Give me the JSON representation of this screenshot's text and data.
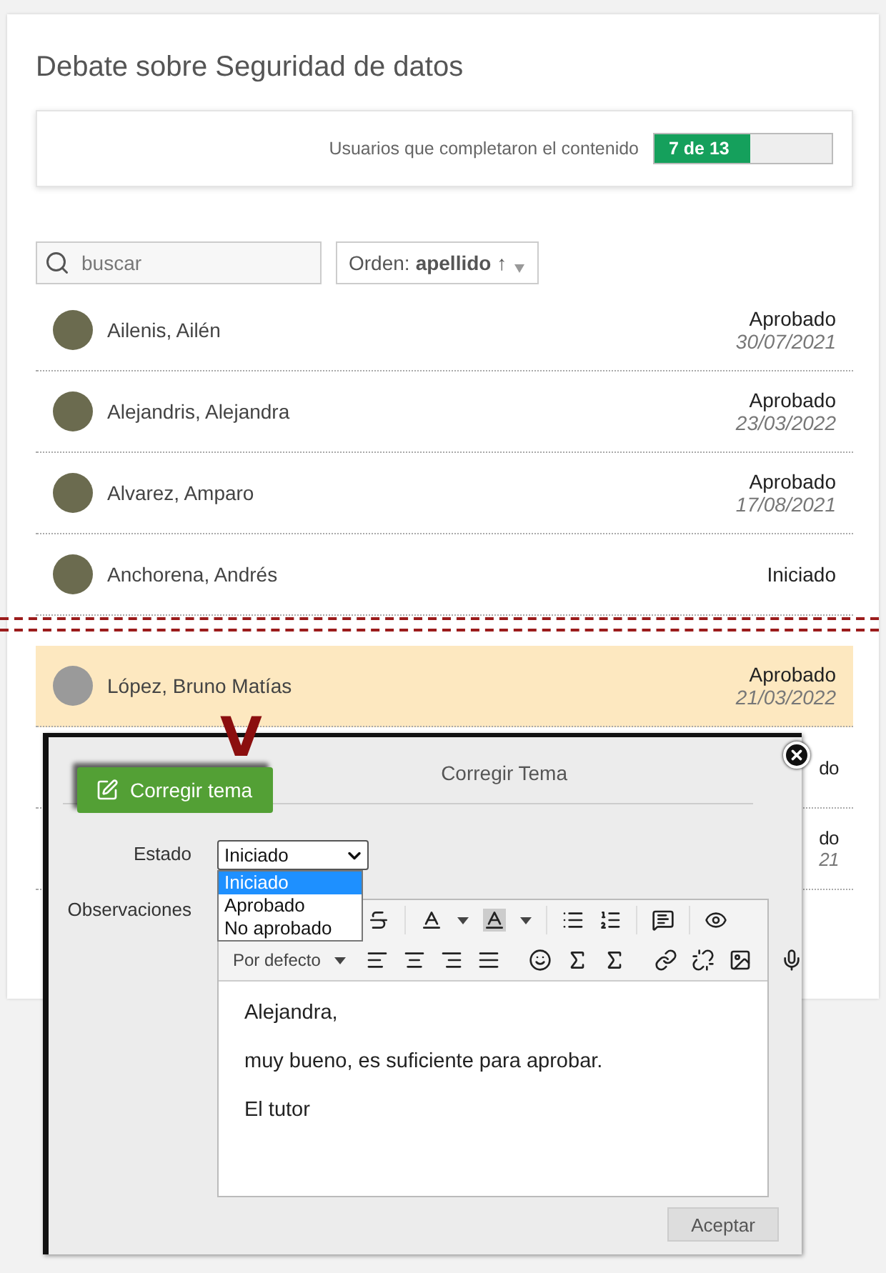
{
  "title": "Debate sobre Seguridad de datos",
  "progress": {
    "label": "Usuarios que completaron el contenido",
    "value": "7 de 13",
    "level": 0.54
  },
  "search": {
    "placeholder": "buscar"
  },
  "sort": {
    "label": "Orden:",
    "value": "apellido ↑"
  },
  "users": [
    {
      "name": "Ailenis, Ailén",
      "status": "Aprobado",
      "date": "30/07/2021",
      "kind": "photo",
      "highlighted": false
    },
    {
      "name": "Alejandris, Alejandra",
      "status": "Aprobado",
      "date": "23/03/2022",
      "kind": "photo",
      "highlighted": false
    },
    {
      "name": "Alvarez, Amparo",
      "status": "Aprobado",
      "date": "17/08/2021",
      "kind": "photo",
      "highlighted": false
    },
    {
      "name": "Anchorena, Andrés",
      "status": "Iniciado",
      "kind": "photo",
      "highlighted": false
    }
  ],
  "users_after_cut": [
    {
      "name": "López, Bruno Matías",
      "status": "Aprobado",
      "date": "21/03/2022",
      "kind": "silhouette",
      "highlighted": true
    }
  ],
  "covered_rows": [
    {
      "status": "do"
    },
    {
      "status": "do",
      "date": "21"
    }
  ],
  "marker": "V",
  "dialog": {
    "title": "Corregir Tema",
    "tab_button": "Corregir tema",
    "estado": {
      "label": "Estado",
      "value": "Iniciado",
      "open": true,
      "options": [
        {
          "label": "Iniciado",
          "selected": true
        },
        {
          "label": "Aprobado",
          "selected": false
        },
        {
          "label": "No aprobado",
          "selected": false
        }
      ]
    },
    "observaciones": {
      "label": "Observaciones",
      "format": "Por defecto",
      "paragraphs": [
        "Alejandra,",
        "muy bueno, es suficiente para aprobar.",
        "El tutor"
      ]
    },
    "accept": "Aceptar"
  }
}
